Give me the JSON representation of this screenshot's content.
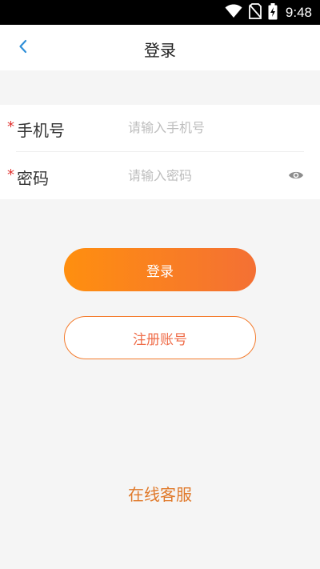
{
  "status_bar": {
    "time": "9:48",
    "icons": [
      "wifi-icon",
      "no-sim-icon",
      "battery-charging-icon"
    ]
  },
  "nav": {
    "title": "登录",
    "back_icon": "chevron-left-icon"
  },
  "form": {
    "phone": {
      "required_mark": "*",
      "label": "手机号",
      "placeholder": "请输入手机号",
      "value": ""
    },
    "password": {
      "required_mark": "*",
      "label": "密码",
      "placeholder": "请输入密码",
      "value": "",
      "toggle_icon": "eye-icon"
    }
  },
  "buttons": {
    "login_label": "登录",
    "register_label": "注册账号"
  },
  "footer": {
    "support_label": "在线客服"
  },
  "colors": {
    "accent_start": "#ff8f0f",
    "accent_end": "#f47034",
    "register_text": "#ef6c48",
    "support_text": "#e0792a",
    "required": "#e0322f",
    "back_arrow": "#2f8fd8"
  }
}
